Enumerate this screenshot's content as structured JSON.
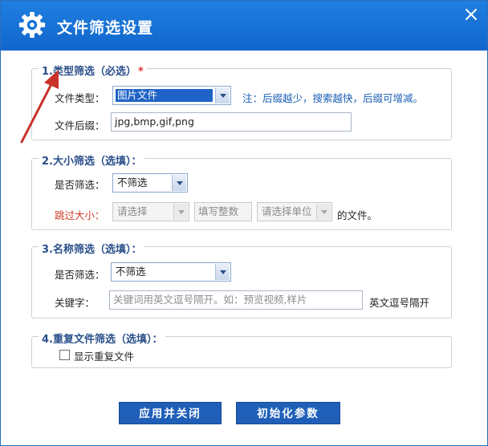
{
  "window": {
    "title": "文件筛选设置"
  },
  "type_filter": {
    "legend": "1.类型筛选（必选）",
    "required_mark": "*",
    "file_type_label": "文件类型：",
    "file_type_value": "图片文件",
    "note": "注：后缀越少，搜索越快，后缀可增减。",
    "suffix_label": "文件后缀：",
    "suffix_value": "jpg,bmp,gif,png"
  },
  "size_filter": {
    "legend": "2.大小筛选（选填）：",
    "enable_label": "是否筛选：",
    "enable_value": "不筛选",
    "skip_label": "跳过大小：",
    "compare_value": "请选择",
    "number_placeholder": "填写整数",
    "unit_value": "请选择单位",
    "suffix_text": "的文件。"
  },
  "name_filter": {
    "legend": "3.名称筛选（选填）：",
    "enable_label": "是否筛选：",
    "enable_value": "不筛选",
    "keyword_label": "关键字：",
    "keyword_placeholder": "关键词用英文逗号隔开。如：预览视频,样片",
    "hint": "英文逗号隔开"
  },
  "dup_filter": {
    "legend": "4.重复文件筛选（选填）：",
    "checkbox_label": "显示重复文件",
    "checked": false
  },
  "buttons": {
    "apply": "应用并关闭",
    "reset": "初始化参数"
  },
  "colors": {
    "title_bar": "#1166cc",
    "button": "#1f5fb8",
    "legend": "#2a4f8a",
    "required": "#e0312a",
    "note": "#1a5fb4",
    "skip_label": "#d23a2a"
  },
  "icons": {
    "title": "gear-icon",
    "close": "close-icon",
    "annotation": "red-arrow-icon"
  }
}
